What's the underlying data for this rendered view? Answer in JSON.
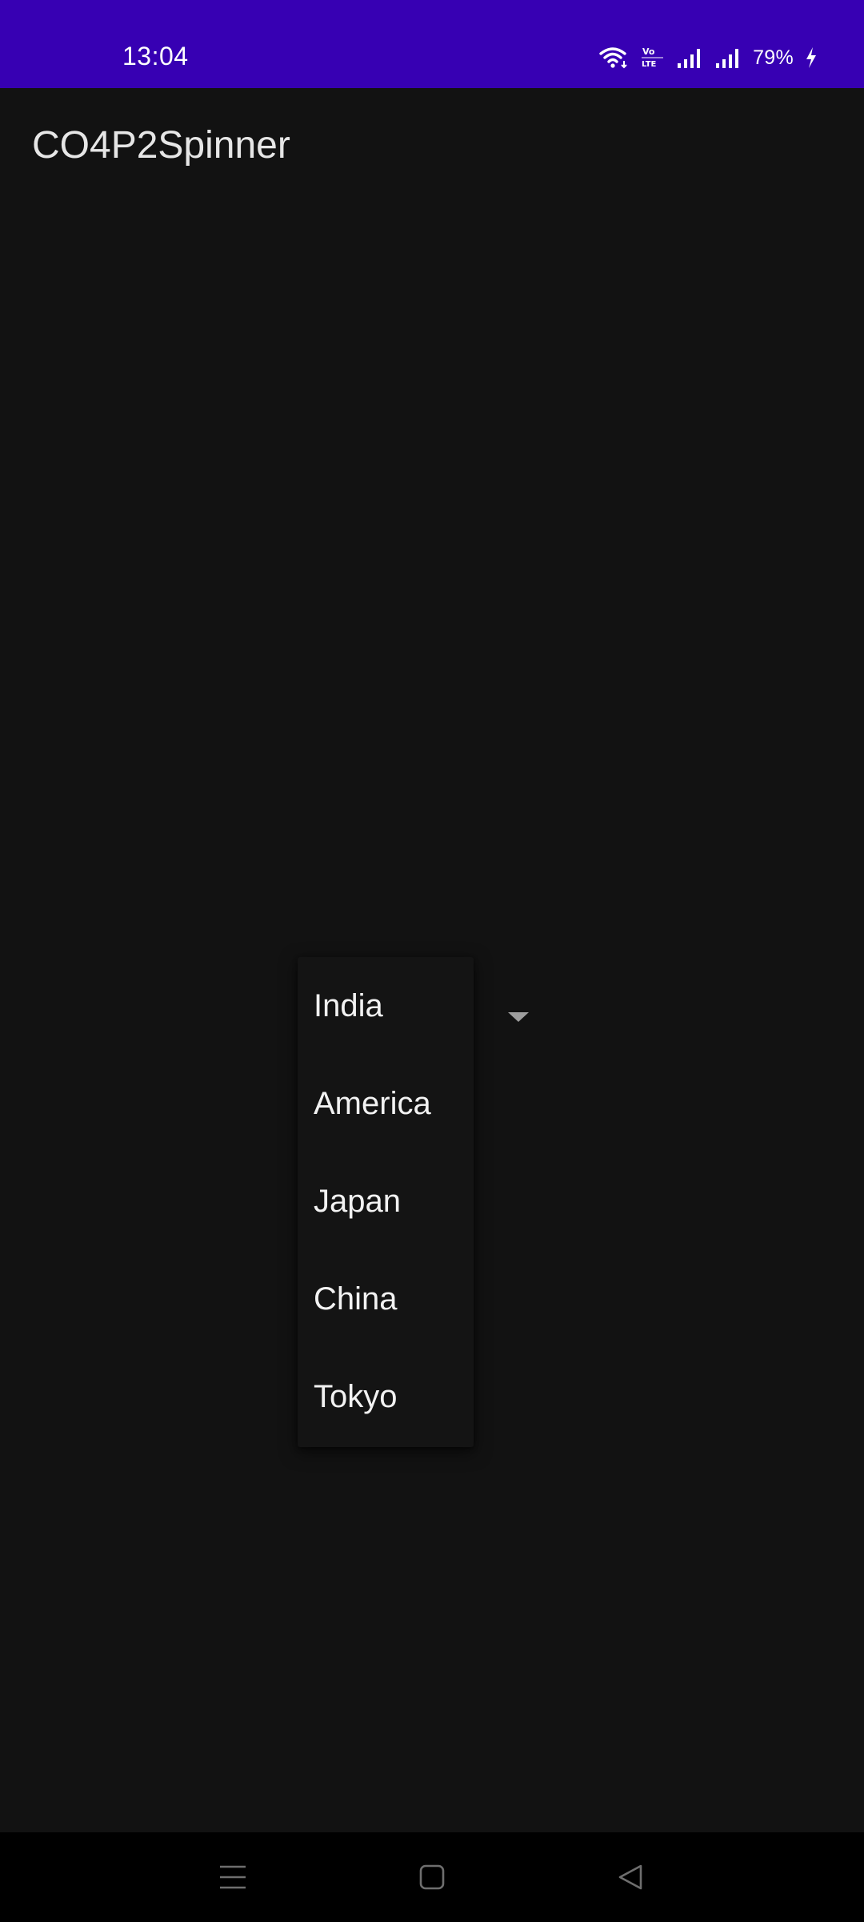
{
  "status_bar": {
    "time": "13:04",
    "battery_percent": "79%",
    "icons": [
      "wifi-icon",
      "volte-icon",
      "signal-icon",
      "signal-icon",
      "charging-icon"
    ]
  },
  "app_bar": {
    "title": "CO4P2Spinner"
  },
  "spinner": {
    "selected": "India",
    "options": [
      "India",
      "America",
      "Japan",
      "China",
      "Tokyo"
    ]
  },
  "nav_bar": {
    "buttons": [
      "menu-icon",
      "home-icon",
      "back-icon"
    ]
  },
  "colors": {
    "status_bar": "#3700b3",
    "background": "#121212",
    "dropdown": "#141414",
    "nav_bar": "#000000"
  }
}
